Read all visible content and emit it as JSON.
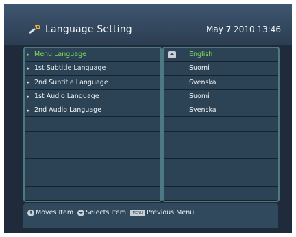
{
  "header": {
    "title": "Language Setting",
    "datetime": "May 7 2010 13:46",
    "icon": "wrench-icon"
  },
  "settings": [
    {
      "label": "Menu Language",
      "value": "English",
      "selected": true
    },
    {
      "label": "1st Subtitle Language",
      "value": "Suomi",
      "selected": false
    },
    {
      "label": "2nd Subtitle Language",
      "value": "Svenska",
      "selected": false
    },
    {
      "label": "1st Audio Language",
      "value": "Suomi",
      "selected": false
    },
    {
      "label": "2nd Audio Language",
      "value": "Svenska",
      "selected": false
    }
  ],
  "empty_rows": 6,
  "help": {
    "moves": "Moves Item",
    "selects": "Selects Item",
    "menu_key": "MENU",
    "previous": "Previous Menu"
  },
  "colors": {
    "selected_text": "#7fd95a",
    "panel_bg": "#2c4356",
    "panel_border": "#4d7a82"
  }
}
